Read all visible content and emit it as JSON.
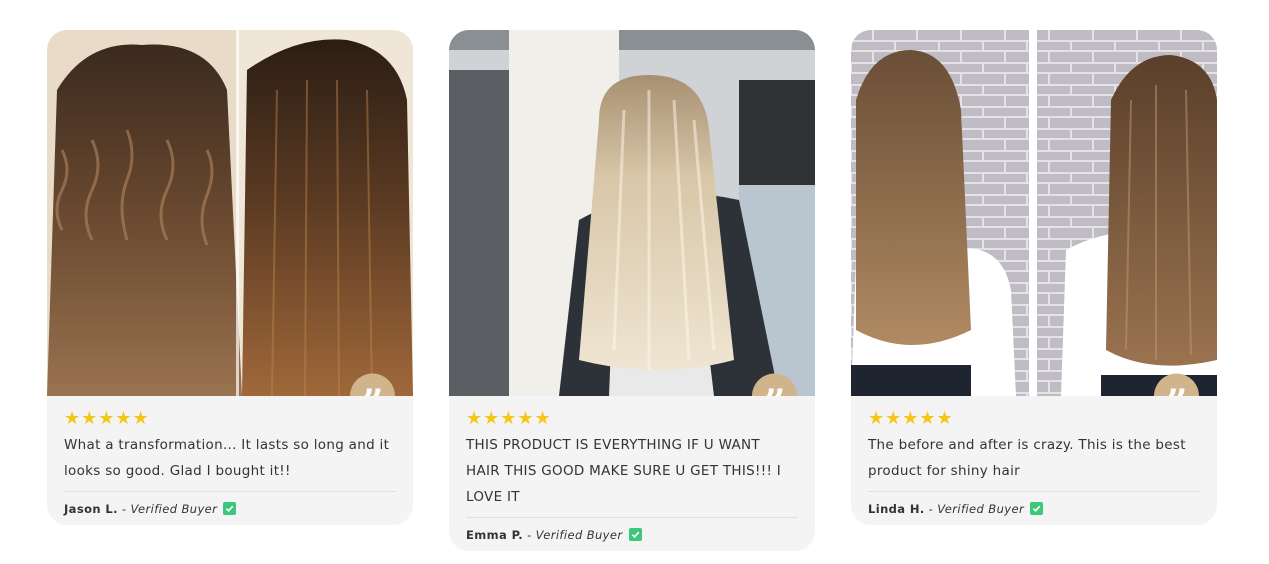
{
  "colors": {
    "accent": "#cfb48c",
    "star": "#f5c518",
    "verified": "#3cc77a",
    "card_bg": "#f4f4f4"
  },
  "reviews": [
    {
      "rating": "★★★★★",
      "text": "What a transformation... It lasts so long and it looks so good. Glad I bought it!!",
      "author": "Jason L.",
      "separator": "-",
      "badge": "Verified Buyer",
      "photo": "before-after-curly-to-straight-brunette"
    },
    {
      "rating": "★★★★★",
      "text": "THIS PRODUCT IS EVERYTHING IF U WANT HAIR THIS GOOD MAKE SURE U GET THIS!!! I LOVE IT",
      "author": "Emma P.",
      "separator": "-",
      "badge": "Verified Buyer",
      "photo": "long-straight-blonde-hair-back-view"
    },
    {
      "rating": "★★★★★",
      "text": "The before and after is crazy. This is the best product for shiny hair",
      "author": "Linda H.",
      "separator": "-",
      "badge": "Verified Buyer",
      "photo": "before-after-wavy-to-sleek-light-brown"
    }
  ],
  "icons": {
    "quote": "quote-icon",
    "star": "star-icon",
    "check": "check-icon"
  }
}
